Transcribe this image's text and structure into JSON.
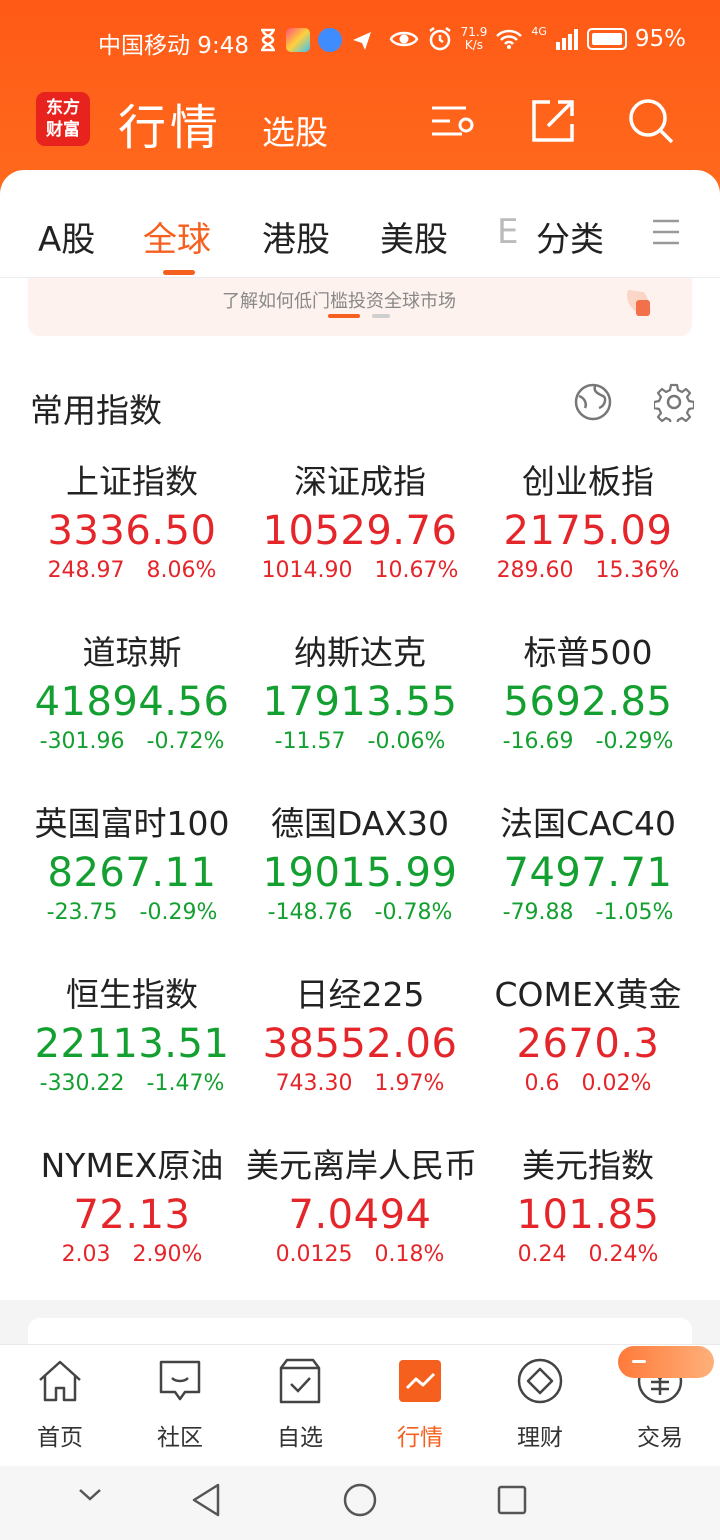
{
  "status_bar": {
    "carrier_time": "中国移动 9:48",
    "net_speed_value": "71.9",
    "net_speed_unit": "K/s",
    "signal": "4G",
    "battery": "95%"
  },
  "header": {
    "logo_line1": "东方",
    "logo_line2": "财富",
    "title": "行情",
    "subtitle": "选股"
  },
  "tabs": [
    {
      "label": "A股"
    },
    {
      "label": "全球"
    },
    {
      "label": "港股"
    },
    {
      "label": "美股"
    },
    {
      "label": "E"
    },
    {
      "label": "分类"
    }
  ],
  "active_tab": "全球",
  "banner": {
    "text": "了解如何低门槛投资全球市场"
  },
  "section": {
    "title": "常用指数"
  },
  "indices": [
    {
      "name": "上证指数",
      "price": "3336.50",
      "change": "248.97",
      "pct": "8.06%",
      "dir": "up"
    },
    {
      "name": "深证成指",
      "price": "10529.76",
      "change": "1014.90",
      "pct": "10.67%",
      "dir": "up"
    },
    {
      "name": "创业板指",
      "price": "2175.09",
      "change": "289.60",
      "pct": "15.36%",
      "dir": "up"
    },
    {
      "name": "道琼斯",
      "price": "41894.56",
      "change": "-301.96",
      "pct": "-0.72%",
      "dir": "down"
    },
    {
      "name": "纳斯达克",
      "price": "17913.55",
      "change": "-11.57",
      "pct": "-0.06%",
      "dir": "down"
    },
    {
      "name": "标普500",
      "price": "5692.85",
      "change": "-16.69",
      "pct": "-0.29%",
      "dir": "down"
    },
    {
      "name": "英国富时100",
      "price": "8267.11",
      "change": "-23.75",
      "pct": "-0.29%",
      "dir": "down"
    },
    {
      "name": "德国DAX30",
      "price": "19015.99",
      "change": "-148.76",
      "pct": "-0.78%",
      "dir": "down"
    },
    {
      "name": "法国CAC40",
      "price": "7497.71",
      "change": "-79.88",
      "pct": "-1.05%",
      "dir": "down"
    },
    {
      "name": "恒生指数",
      "price": "22113.51",
      "change": "-330.22",
      "pct": "-1.47%",
      "dir": "down"
    },
    {
      "name": "日经225",
      "price": "38552.06",
      "change": "743.30",
      "pct": "1.97%",
      "dir": "up"
    },
    {
      "name": "COMEX黄金",
      "price": "2670.3",
      "change": "0.6",
      "pct": "0.02%",
      "dir": "up"
    },
    {
      "name": "NYMEX原油",
      "price": "72.13",
      "change": "2.03",
      "pct": "2.90%",
      "dir": "up"
    },
    {
      "name": "美元离岸人民币",
      "price": "7.0494",
      "change": "0.0125",
      "pct": "0.18%",
      "dir": "up"
    },
    {
      "name": "美元指数",
      "price": "101.85",
      "change": "0.24",
      "pct": "0.24%",
      "dir": "up"
    }
  ],
  "bottom_nav": [
    {
      "label": "首页",
      "icon": "home-icon"
    },
    {
      "label": "社区",
      "icon": "chat-icon"
    },
    {
      "label": "自选",
      "icon": "watchlist-icon"
    },
    {
      "label": "行情",
      "icon": "market-icon"
    },
    {
      "label": "理财",
      "icon": "wealth-icon"
    },
    {
      "label": "交易",
      "icon": "trade-icon"
    }
  ],
  "colors": {
    "brand": "#f5601e",
    "up": "#e4262b",
    "down": "#14a031"
  }
}
